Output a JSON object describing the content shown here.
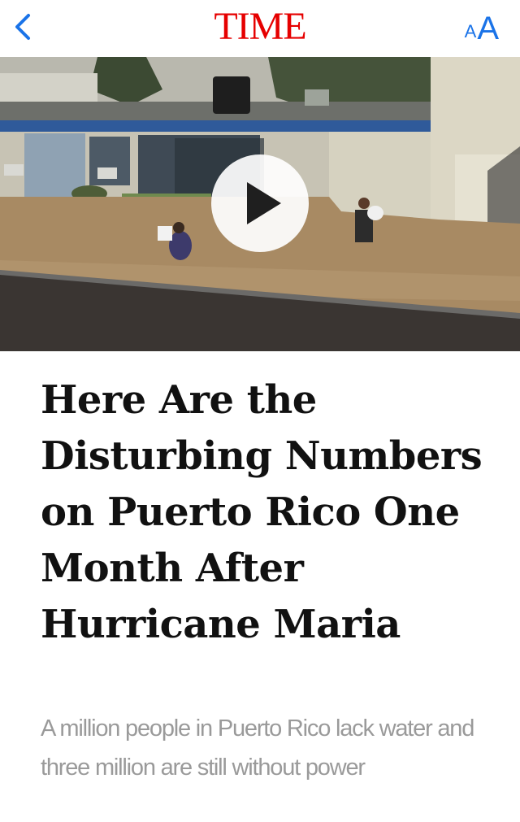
{
  "header": {
    "logo": "TIME",
    "text_size_small": "A",
    "text_size_large": "A",
    "brand_color": "#e60000",
    "accent_color": "#1a73e8"
  },
  "media": {
    "type": "video",
    "play_icon": "play-icon"
  },
  "article": {
    "headline": "Here Are the Disturbing Numbers on Puerto Rico One Month After Hurricane Maria",
    "subhead": "A million people in Puerto Rico lack water and three million are still without power"
  }
}
